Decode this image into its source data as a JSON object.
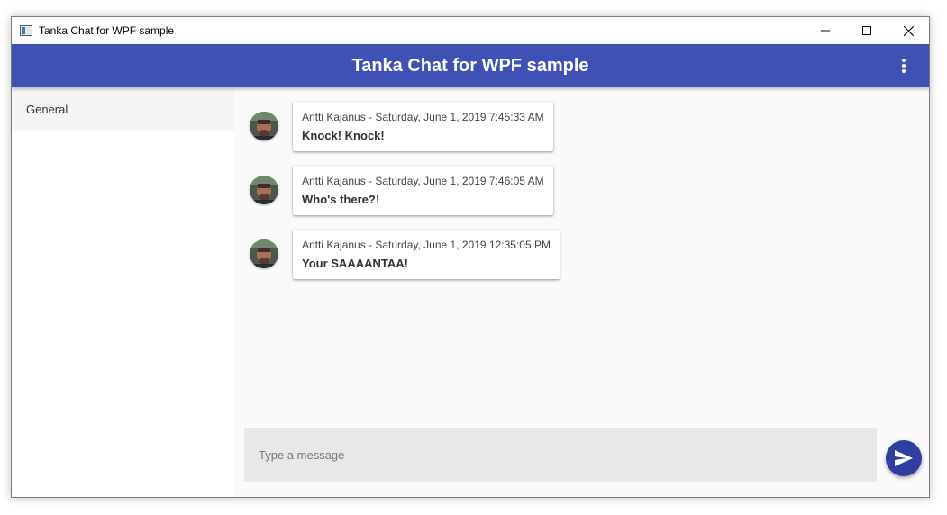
{
  "window": {
    "title": "Tanka Chat for WPF sample"
  },
  "appbar": {
    "title": "Tanka Chat for WPF sample",
    "menu_icon": "more-vert-icon"
  },
  "sidebar": {
    "channels": [
      {
        "label": "General",
        "selected": true
      }
    ]
  },
  "messages": [
    {
      "author": "Antti Kajanus",
      "header": "Antti Kajanus - Saturday, June 1, 2019 7:45:33 AM",
      "text": "Knock! Knock!"
    },
    {
      "author": "Antti Kajanus",
      "header": "Antti Kajanus - Saturday, June 1, 2019 7:46:05 AM",
      "text": "Who's there?!"
    },
    {
      "author": "Antti Kajanus",
      "header": "Antti Kajanus - Saturday, June 1, 2019 12:35:05 PM",
      "text": "Your SAAAANTAA!"
    }
  ],
  "composer": {
    "placeholder": "Type a message",
    "value": "",
    "send_icon": "send-icon"
  },
  "colors": {
    "primary": "#3f51b5",
    "primary_dark": "#303f9f",
    "main_bg": "#fafafa",
    "sidebar_selected": "#f5f5f5"
  }
}
